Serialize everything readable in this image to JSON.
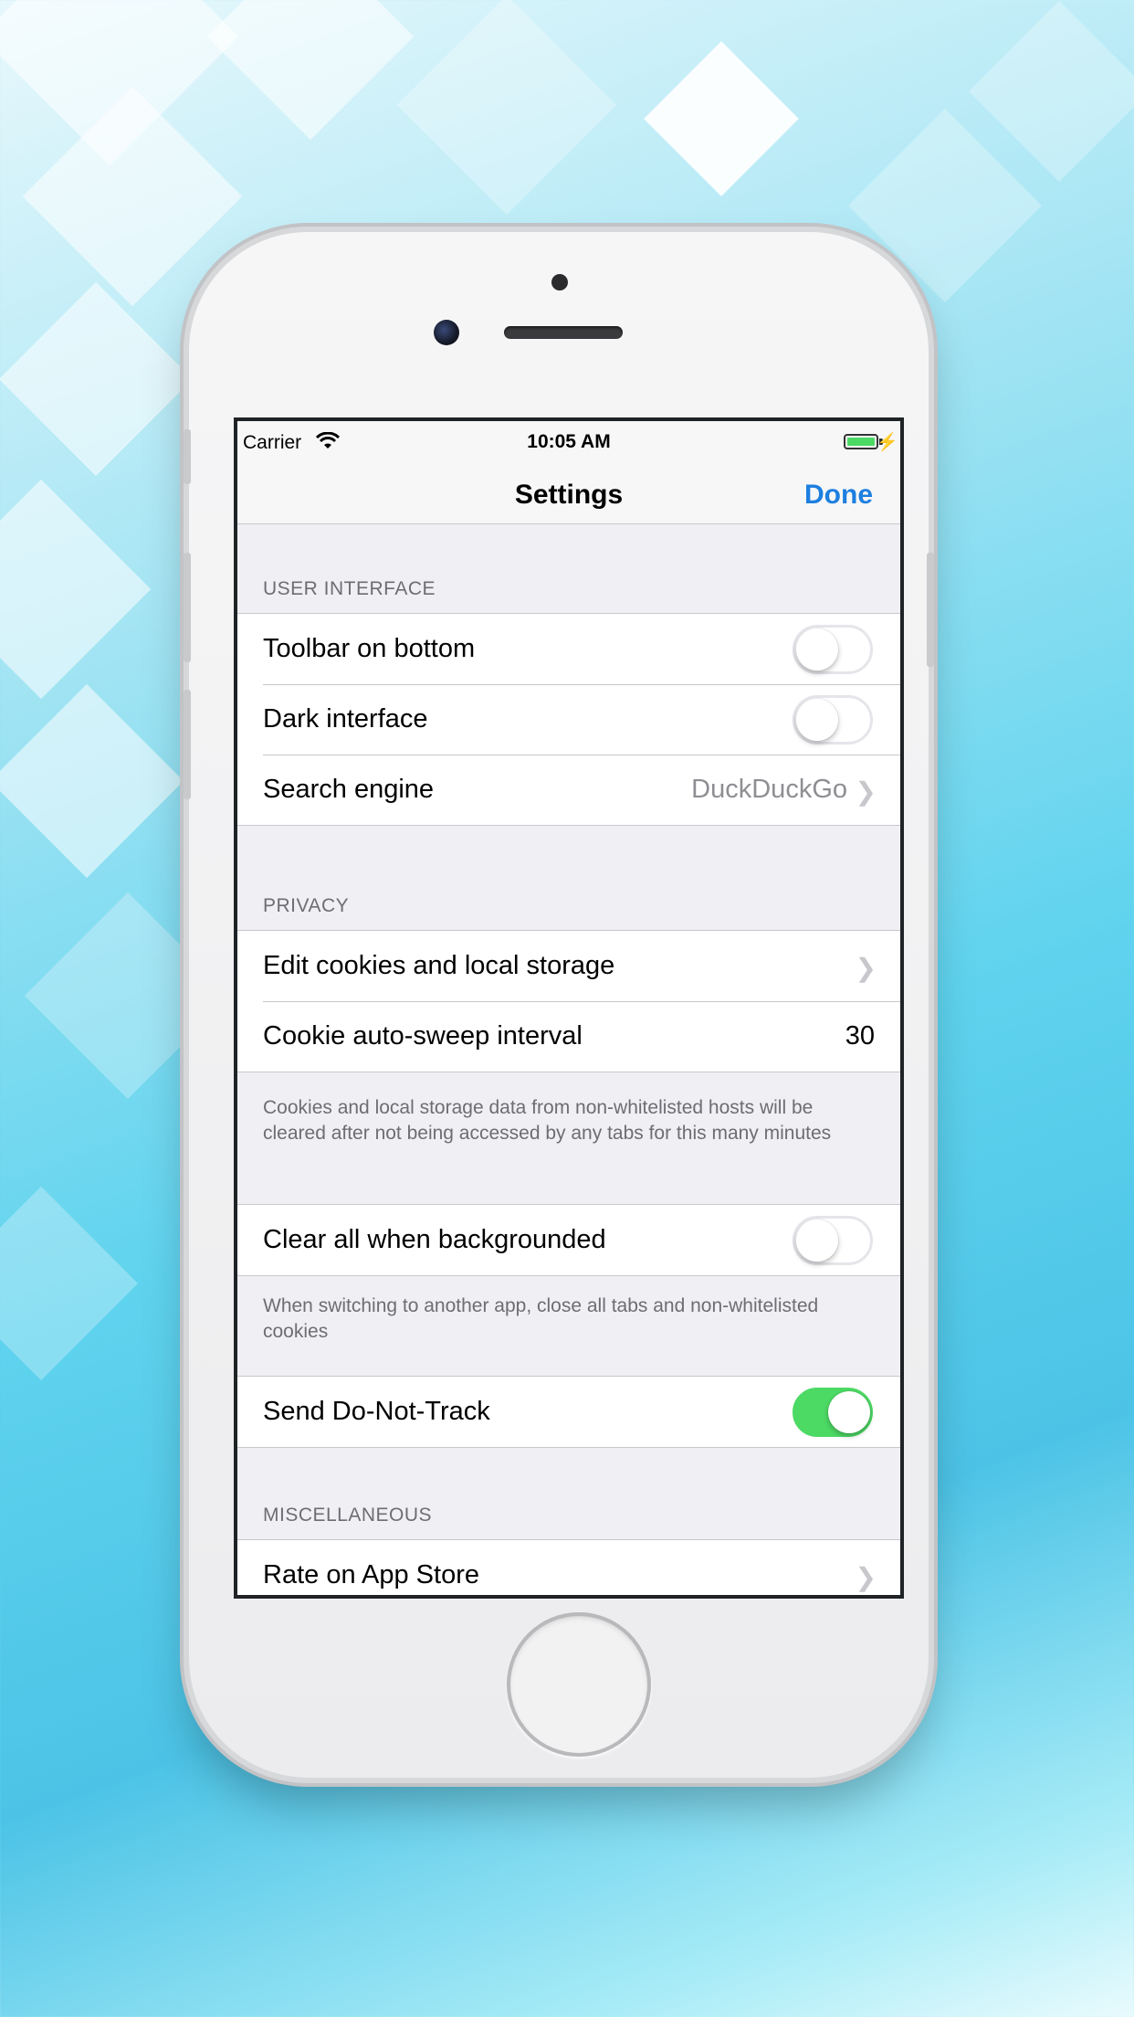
{
  "status_bar": {
    "carrier": "Carrier",
    "time": "10:05 AM"
  },
  "nav": {
    "title": "Settings",
    "done_label": "Done"
  },
  "sections": {
    "user_interface": {
      "header": "USER INTERFACE",
      "toolbar_on_bottom": {
        "label": "Toolbar on bottom",
        "on": false
      },
      "dark_interface": {
        "label": "Dark interface",
        "on": false
      },
      "search_engine": {
        "label": "Search engine",
        "value": "DuckDuckGo"
      }
    },
    "privacy": {
      "header": "PRIVACY",
      "edit_cookies": {
        "label": "Edit cookies and local storage"
      },
      "cookie_sweep": {
        "label": "Cookie auto-sweep interval",
        "value": "30"
      },
      "cookie_footer": "Cookies and local storage data from non-whitelisted hosts will be cleared after not being accessed by any tabs for this many minutes",
      "clear_all": {
        "label": "Clear all when backgrounded",
        "on": false
      },
      "clear_footer": "When switching to another app, close all tabs and non-whitelisted cookies",
      "dnt": {
        "label": "Send Do-Not-Track",
        "on": true
      }
    },
    "misc": {
      "header": "MISCELLANEOUS",
      "rate": {
        "label": "Rate on App Store"
      }
    }
  },
  "colors": {
    "accent": "#1d7fe0",
    "toggle_on": "#4cd964"
  }
}
